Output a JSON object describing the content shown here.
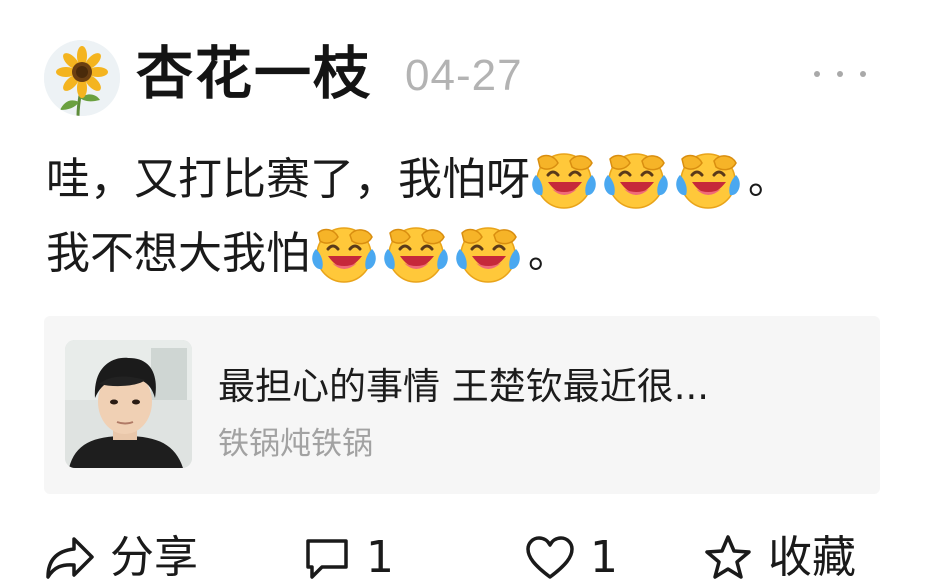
{
  "post": {
    "author": {
      "name": "杏花一枝",
      "avatar_icon": "sunflower-avatar"
    },
    "date": "04-27",
    "more_icon": "more-dots-icon",
    "text": {
      "line1": "哇，又打比赛了，我怕呀",
      "line1_end": "。",
      "line2": "我不想大我怕",
      "line2_end": "。",
      "emoji_name": "laughing-crying-emoji"
    }
  },
  "link_card": {
    "title": "最担心的事情 王楚钦最近很...",
    "source": "铁锅炖铁锅",
    "thumbnail_icon": "person-photo-thumbnail"
  },
  "actions": {
    "share": {
      "icon": "share-icon",
      "label": "分享"
    },
    "comment": {
      "icon": "comment-icon",
      "count": "1"
    },
    "like": {
      "icon": "heart-icon",
      "count": "1"
    },
    "favorite": {
      "icon": "star-icon",
      "label": "收藏"
    }
  },
  "colors": {
    "text": "#1a1a1a",
    "muted": "#b3b3b3",
    "card_bg": "#f6f6f6",
    "source_text": "#a2a2a2"
  }
}
